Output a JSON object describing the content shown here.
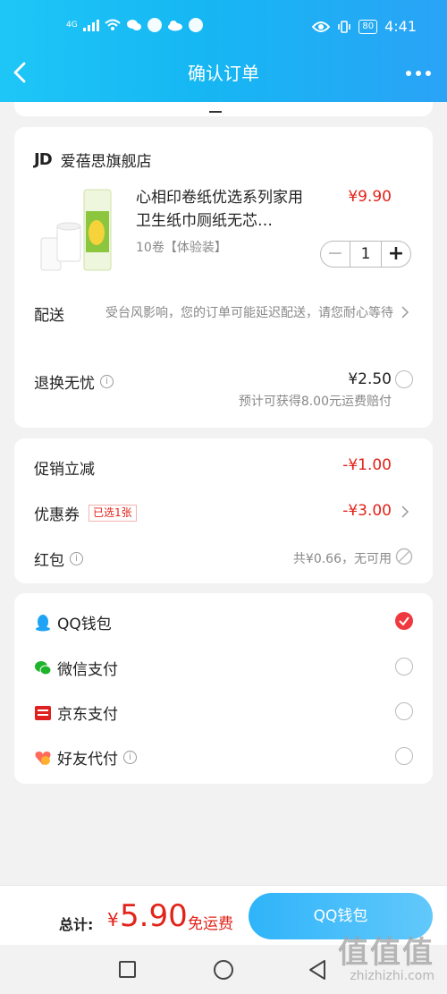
{
  "status_bar": {
    "network": "4G",
    "battery": "80",
    "time": "4:41"
  },
  "header": {
    "title": "确认订单"
  },
  "store": {
    "logo_text": "JD",
    "name": "爱蓓思旗舰店"
  },
  "product": {
    "title": "心相印卷纸优选系列家用卫生纸巾厕纸无芯…",
    "price": "¥9.90",
    "spec": "10卷【体验装】",
    "quantity": "1",
    "minus": "−",
    "plus": "+"
  },
  "delivery": {
    "label": "配送",
    "text": "受台风影响，您的订单可能延迟配送，请您耐心等待"
  },
  "refund": {
    "label": "退换无忧",
    "price": "¥2.50",
    "note": "预计可获得8.00元运费赔付"
  },
  "discounts": {
    "promo_label": "促销立减",
    "promo_value": "-¥1.00",
    "coupon_label": "优惠券",
    "coupon_tag": "已选1张",
    "coupon_value": "-¥3.00",
    "hongbao_label": "红包",
    "hongbao_text": "共¥0.66，无可用"
  },
  "payments": [
    {
      "label": "QQ钱包",
      "icon": "qq-penguin-icon",
      "selected": true
    },
    {
      "label": "微信支付",
      "icon": "wechat-icon",
      "selected": false
    },
    {
      "label": "京东支付",
      "icon": "jd-pay-icon",
      "selected": false
    },
    {
      "label": "好友代付",
      "icon": "friend-pay-icon",
      "selected": false
    }
  ],
  "footer": {
    "total_label": "总计:",
    "currency": "¥",
    "total_value": "5.90",
    "shipping": "免运费",
    "pay_button": "QQ钱包"
  },
  "watermark": {
    "big": "值值值",
    "small": "zhizhizhi.com"
  },
  "colors": {
    "accent_red": "#e2231a",
    "header_blue": "#16b7f3",
    "check_red": "#f0393f"
  }
}
